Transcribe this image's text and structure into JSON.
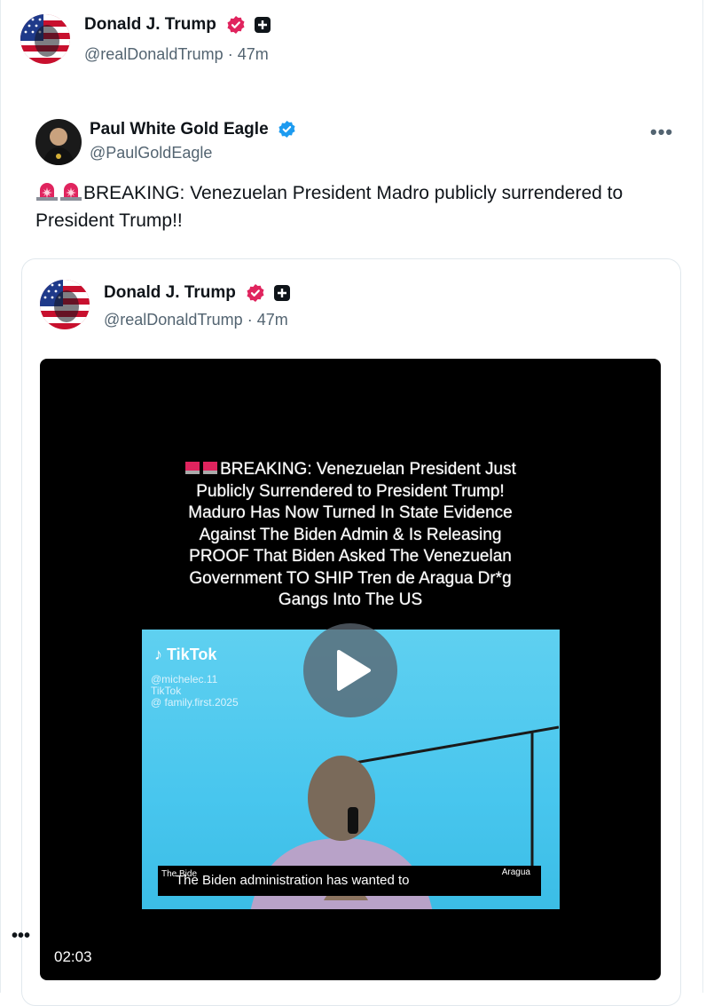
{
  "outer_post": {
    "author_name": "Donald J. Trump",
    "author_handle": "@realDonaldTrump",
    "timestamp": "47m",
    "separator": "·"
  },
  "quoted_post": {
    "author_name": "Paul White Gold Eagle",
    "author_handle": "@PaulGoldEagle",
    "more_label": "•••",
    "text": "BREAKING: Venezuelan President Madro publicly surrendered to President Trump!!",
    "sirens": [
      "🚨",
      "🚨"
    ]
  },
  "inner_post": {
    "author_name": "Donald J. Trump",
    "author_handle": "@realDonaldTrump",
    "timestamp": "47m",
    "separator": "·"
  },
  "video": {
    "caption_lines": [
      "BREAKING: Venezuelan President Just",
      "Publicly Surrendered to President Trump!",
      "Maduro Has Now Turned In State Evidence",
      "Against The Biden Admin & Is Releasing",
      "PROOF That Biden Asked The Venezuelan",
      "Government TO SHIP Tren de Aragua Dr*g",
      "Gangs Into The US"
    ],
    "tiktok_label": "TikTok",
    "tiktok_handles": [
      "@michelec.11",
      "TikTok",
      "@ family.first.2025"
    ],
    "subtitle": "The Biden administration has wanted to",
    "subtitle_left": "The Bide",
    "subtitle_right": "Aragua",
    "duration": "02:03",
    "play_icon": "play-icon"
  },
  "side_dots": "•••",
  "colors": {
    "verified_gold": "#e0245e",
    "verified_blue": "#1d9bf0",
    "handle_gray": "#536471"
  }
}
